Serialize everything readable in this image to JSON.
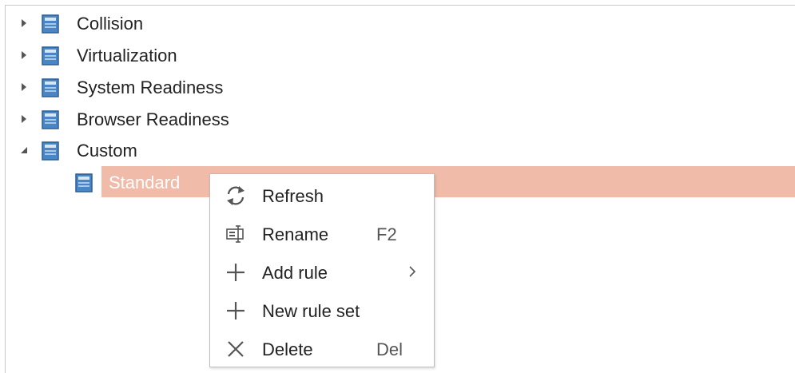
{
  "tree": {
    "items": [
      {
        "label": "Collision",
        "expanded": false
      },
      {
        "label": "Virtualization",
        "expanded": false
      },
      {
        "label": "System Readiness",
        "expanded": false
      },
      {
        "label": "Browser Readiness",
        "expanded": false
      },
      {
        "label": "Custom",
        "expanded": true,
        "children": [
          {
            "label": "Standard",
            "selected": true
          }
        ]
      }
    ]
  },
  "context_menu": {
    "items": [
      {
        "label": "Refresh",
        "icon": "refresh-icon",
        "shortcut": ""
      },
      {
        "label": "Rename",
        "icon": "rename-icon",
        "shortcut": "F2"
      },
      {
        "label": "Add rule",
        "icon": "plus-icon",
        "shortcut": "",
        "submenu": true
      },
      {
        "label": "New rule set",
        "icon": "plus-icon",
        "shortcut": ""
      },
      {
        "label": "Delete",
        "icon": "delete-icon",
        "shortcut": "Del"
      }
    ]
  },
  "colors": {
    "selection": "#f0bba8",
    "book_icon": "#3a7ab8",
    "text": "#222222"
  }
}
